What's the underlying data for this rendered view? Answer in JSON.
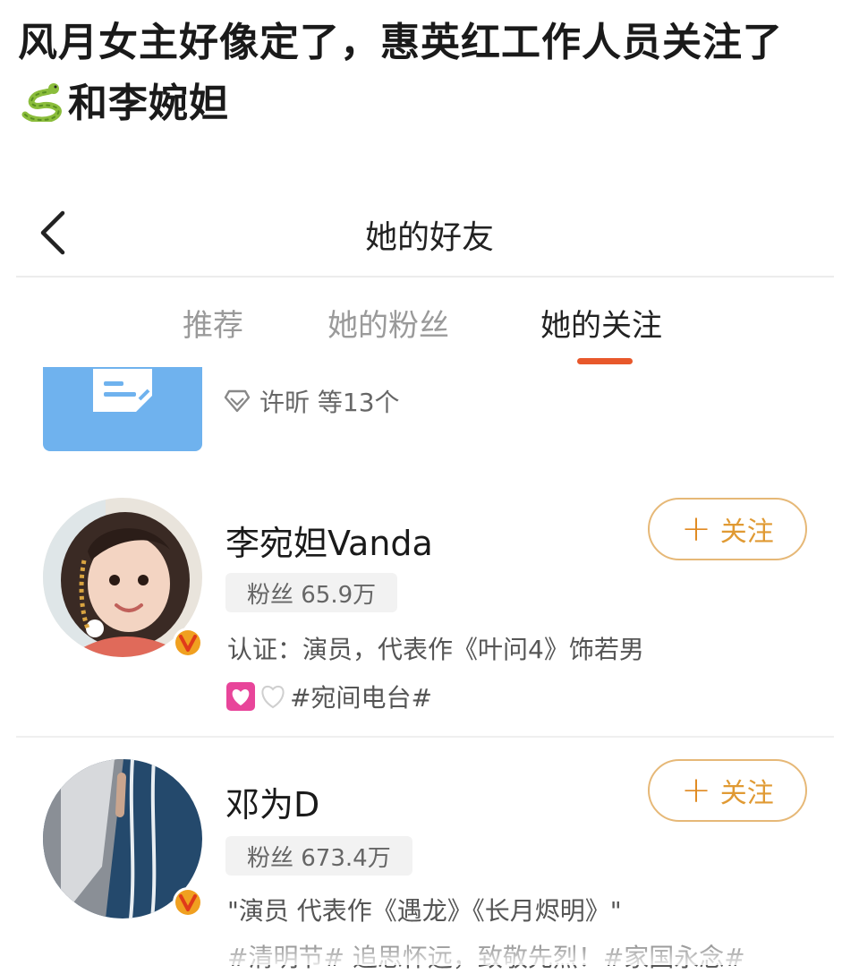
{
  "post": {
    "title_part1": "风月女主好像定了，惠英红工作人员关注了",
    "title_part2": "和李婉妲"
  },
  "nav": {
    "back_icon": "chevron-left-icon",
    "title": "她的好友"
  },
  "tabs": [
    {
      "label": "推荐",
      "active": false
    },
    {
      "label": "她的粉丝",
      "active": false
    },
    {
      "label": "她的关注",
      "active": true
    }
  ],
  "group": {
    "members_text": "许昕 等13个"
  },
  "users": [
    {
      "name": "李宛妲Vanda",
      "follow_label": "关注",
      "fans": "粉丝 65.9万",
      "desc": "认证：演员，代表作《叶问4》饰若男",
      "tag": "#宛间电台#"
    },
    {
      "name": "邓为D",
      "follow_label": "关注",
      "fans": "粉丝 673.4万",
      "desc": "\"演员 代表作《遇龙》《长月烬明》\"",
      "bottom": "#清明节# 追思怀远，致敬先烈！#家国永念#"
    }
  ],
  "colors": {
    "accent": "#e8582b",
    "follow": "#e09a33",
    "verified": "#f0a020"
  }
}
